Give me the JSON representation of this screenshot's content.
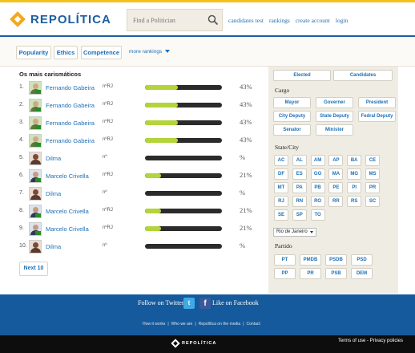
{
  "brand": {
    "name": "REPOLÍTICA"
  },
  "search": {
    "placeholder": "Find a Politician"
  },
  "topnav": [
    "candidates test",
    "rankings",
    "create account",
    "login"
  ],
  "tabs": [
    "Popularity",
    "Ethics",
    "Competence"
  ],
  "more_rankings": "more rankings",
  "list": {
    "title": "Os mais carismáticos",
    "rows": [
      {
        "rank": "1.",
        "name": "Fernando Gabeira",
        "state": "nºRJ",
        "pct_text": "43%",
        "pct": 43
      },
      {
        "rank": "2.",
        "name": "Fernando Gabeira",
        "state": "nºRJ",
        "pct_text": "43%",
        "pct": 43
      },
      {
        "rank": "3.",
        "name": "Fernando Gabeira",
        "state": "nºRJ",
        "pct_text": "43%",
        "pct": 43
      },
      {
        "rank": "4.",
        "name": "Fernando Gabeira",
        "state": "nºRJ",
        "pct_text": "43%",
        "pct": 43
      },
      {
        "rank": "5.",
        "name": "Dilma",
        "state": "nº",
        "pct_text": "%",
        "pct": 0
      },
      {
        "rank": "6.",
        "name": "Marcelo Crivella",
        "state": "nºRJ",
        "pct_text": "21%",
        "pct": 21
      },
      {
        "rank": "7.",
        "name": "Dilma",
        "state": "nº",
        "pct_text": "%",
        "pct": 0
      },
      {
        "rank": "8.",
        "name": "Marcelo Crivella",
        "state": "nºRJ",
        "pct_text": "21%",
        "pct": 21
      },
      {
        "rank": "9.",
        "name": "Marcelo Crivella",
        "state": "nºRJ",
        "pct_text": "21%",
        "pct": 21
      },
      {
        "rank": "10.",
        "name": "Dilma",
        "state": "nº",
        "pct_text": "%",
        "pct": 0
      }
    ],
    "next_label": "Next 10"
  },
  "sidebar": {
    "toggle": [
      "Elected",
      "Candidates"
    ],
    "cargo_label": "Cargo",
    "cargo": [
      "Mayor",
      "Governer",
      "President",
      "City Deputy",
      "State Deputy",
      "Fedral Deputy",
      "Senator",
      "Minister"
    ],
    "state_label": "State/City",
    "states": [
      "AC",
      "AL",
      "AM",
      "AP",
      "BA",
      "CE",
      "DF",
      "ES",
      "GO",
      "MA",
      "MG",
      "MS",
      "MT",
      "PA",
      "PB",
      "PE",
      "PI",
      "PR",
      "RJ",
      "RN",
      "RO",
      "RR",
      "RS",
      "SC",
      "SE",
      "SP",
      "TO"
    ],
    "city_select": "Rio de Janeiro",
    "partido_label": "Partido",
    "parties": [
      "PT",
      "PMDB",
      "PSDB",
      "PSD",
      "PP",
      "PR",
      "PSB",
      "DEM"
    ]
  },
  "footer": {
    "follow": "Follow on Twitter",
    "like": "Like on Facebook",
    "links": [
      "How it works",
      "Who we are",
      "Repolítica on the media",
      "Contact"
    ],
    "bottom_brand": "REPOLÍTICA",
    "terms": "Terms of use - Privacy policies"
  },
  "colors": {
    "accent": "#1d5fa0",
    "bar_fill": "#b3d43a",
    "bar_track": "#2b2b2b",
    "stripe": "#f4c21a"
  }
}
